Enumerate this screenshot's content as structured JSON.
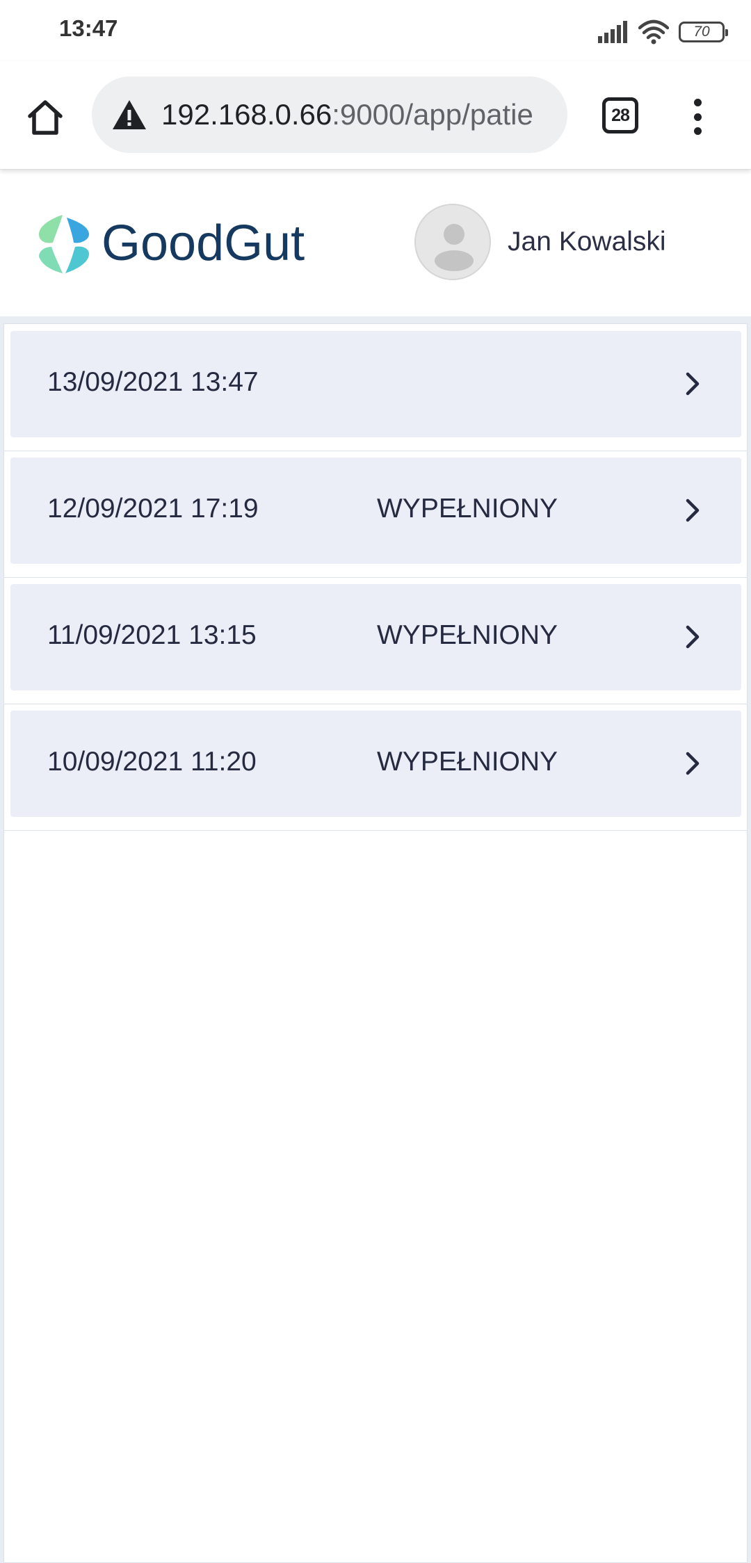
{
  "status_bar": {
    "time": "13:47",
    "battery": "70",
    "icons": [
      "signal-icon",
      "wifi-icon",
      "battery-icon"
    ]
  },
  "browser": {
    "url_host": "192.168.0.66",
    "url_path": ":9000/app/patie",
    "tab_count": "28",
    "icons": [
      "home-icon",
      "warning-icon",
      "tabs-icon",
      "more-vert-icon"
    ]
  },
  "header": {
    "brand": "GoodGut",
    "user_name": "Jan Kowalski",
    "colors": {
      "brand_text": "#163a5f",
      "logo_green": "#8fe0a8",
      "logo_teal": "#4fc7d3",
      "logo_blue": "#3aa6e0"
    }
  },
  "entries": [
    {
      "date": "13/09/2021 13:47",
      "status": ""
    },
    {
      "date": "12/09/2021 17:19",
      "status": "WYPEŁNIONY"
    },
    {
      "date": "11/09/2021 13:15",
      "status": "WYPEŁNIONY"
    },
    {
      "date": "10/09/2021 11:20",
      "status": "WYPEŁNIONY"
    }
  ]
}
